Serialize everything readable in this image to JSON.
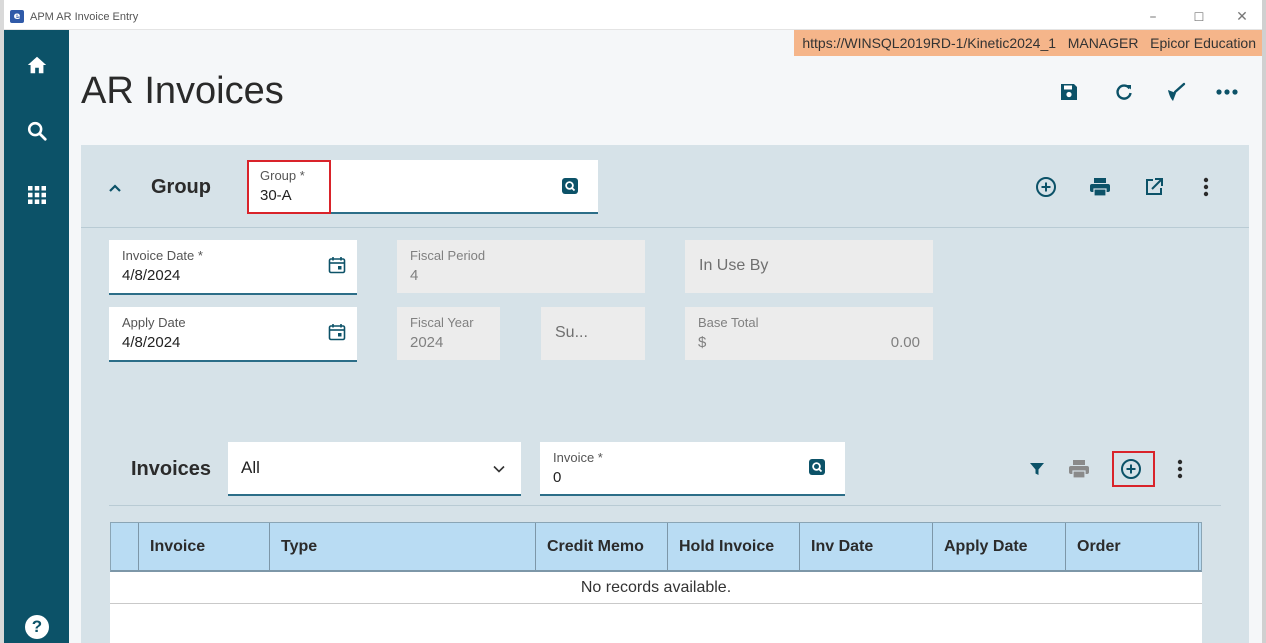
{
  "window": {
    "title": "APM AR Invoice Entry",
    "logo_glyph": "e",
    "controls": [
      "–",
      "☐",
      "✕"
    ]
  },
  "environment_banner": "https://WINSQL2019RD-1/Kinetic2024_1   MANAGER   Epicor Education",
  "page_title": "AR Invoices",
  "nav": {
    "icons": [
      "home-icon",
      "search-icon",
      "apps-grid-icon",
      "help-icon"
    ],
    "help_glyph": "?"
  },
  "group": {
    "label": "Group",
    "group_field": {
      "label": "Group *",
      "value": "30-A"
    },
    "invoice_date": {
      "label": "Invoice Date *",
      "value": "4/8/2024"
    },
    "apply_date": {
      "label": "Apply Date",
      "value": "4/8/2024"
    },
    "fiscal_period": {
      "label": "Fiscal Period",
      "value": "4"
    },
    "fiscal_year": {
      "label": "Fiscal Year",
      "value": "2024"
    },
    "fiscal_suffix": {
      "value": "Su..."
    },
    "in_use_by": {
      "label": "In Use By"
    },
    "base_total": {
      "label": "Base Total",
      "currency": "$",
      "value": "0.00"
    }
  },
  "invoices": {
    "label": "Invoices",
    "filter": {
      "value": "All"
    },
    "invoice_field": {
      "label": "Invoice *",
      "value": "0"
    },
    "table": {
      "columns": [
        "",
        "Invoice",
        "Type",
        "Credit Memo",
        "Hold Invoice",
        "Inv Date",
        "Apply Date",
        "Order"
      ],
      "empty_message": "No records available."
    }
  },
  "colors": {
    "nav_bg": "#0c5268",
    "accent": "#2c6e88",
    "highlight": "#d9232a",
    "banner": "#f5b58a",
    "table_header": "#b9dcf3"
  }
}
